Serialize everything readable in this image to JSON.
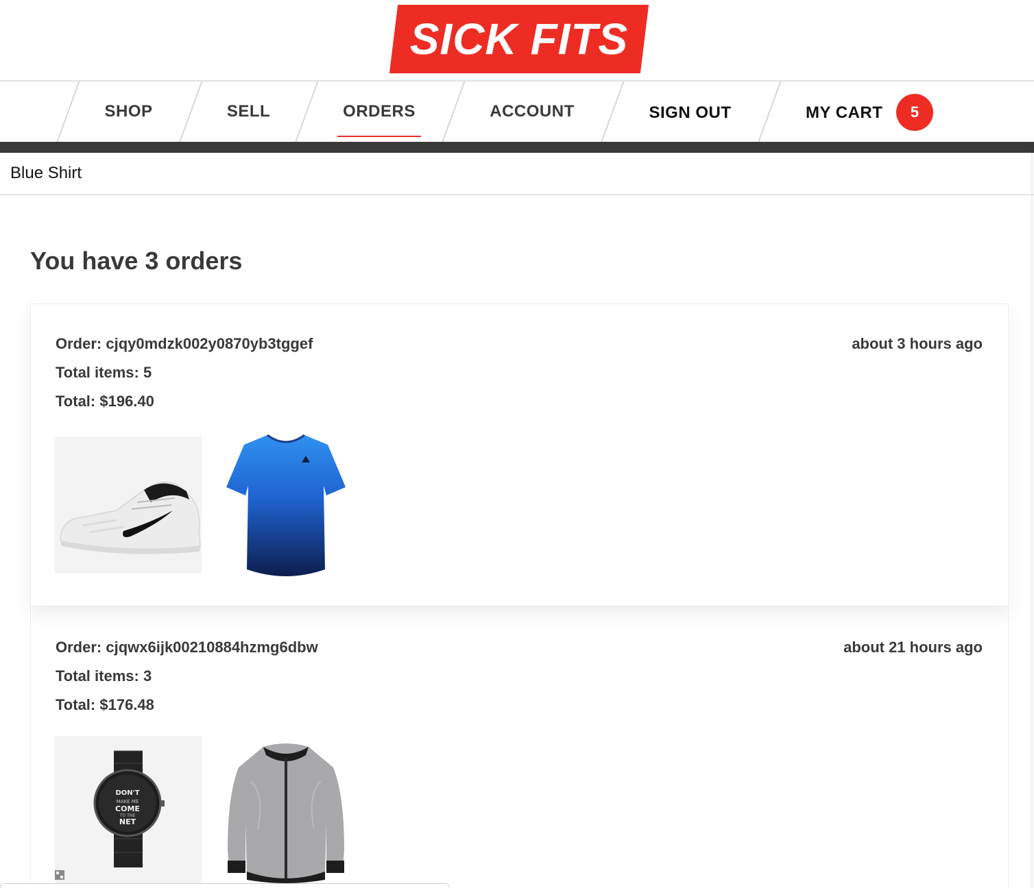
{
  "brand": {
    "logo_text": "SICK FITS",
    "accent": "#ed2d24",
    "dark": "#393939"
  },
  "nav": {
    "items": [
      {
        "label": "SHOP"
      },
      {
        "label": "SELL"
      },
      {
        "label": "ORDERS"
      },
      {
        "label": "ACCOUNT"
      },
      {
        "label": "SIGN OUT"
      },
      {
        "label": "MY CART"
      }
    ],
    "active": "ORDERS",
    "cart_count": "5"
  },
  "search": {
    "value": "Blue Shirt"
  },
  "page": {
    "title": "You have 3 orders"
  },
  "orders": [
    {
      "id_label": "Order: cjqy0mdzk002y0870yb3tggef",
      "items_label": "Total items: 5",
      "total_label": "Total: $196.40",
      "time": "about 3 hours ago",
      "thumbnails": [
        "sneaker-image",
        "blue-shirt-image"
      ]
    },
    {
      "id_label": "Order: cjqwx6ijk00210884hzmg6dbw",
      "items_label": "Total items: 3",
      "total_label": "Total: $176.48",
      "time": "about 21 hours ago",
      "thumbnails": [
        "watch-image",
        "grey-jacket-image"
      ],
      "watch_face_text": "DON'T MAKE ME COME TO THE NET"
    }
  ]
}
